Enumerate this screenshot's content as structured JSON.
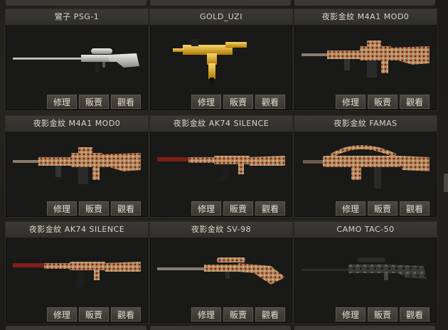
{
  "buttons": {
    "repair": "修理",
    "sell": "販賣",
    "view": "觀看"
  },
  "items": [
    {
      "name": "鸞子 PSG-1",
      "kind": "sniper-silver"
    },
    {
      "name": "GOLD_UZI",
      "kind": "uzi-gold"
    },
    {
      "name": "夜影金紋 M4A1 MOD0",
      "kind": "m4a1-pattern"
    },
    {
      "name": "夜影金紋 M4A1 MOD0",
      "kind": "m4a1-pattern"
    },
    {
      "name": "夜影金紋 AK74 SILENCE",
      "kind": "ak74-pattern"
    },
    {
      "name": "夜影金紋 FAMAS",
      "kind": "famas-pattern"
    },
    {
      "name": "夜影金紋 AK74 SILENCE",
      "kind": "ak74-pattern"
    },
    {
      "name": "夜影金紋 SV-98",
      "kind": "sv98-pattern"
    },
    {
      "name": "CAMO TAC-50",
      "kind": "tac50-camo"
    }
  ],
  "colors": {
    "gold": "#d9a21a",
    "pattern_base": "#b38a5e",
    "pattern_accent": "#7d1f1a",
    "silver": "#c9c9c4",
    "dark_steel": "#232323"
  }
}
